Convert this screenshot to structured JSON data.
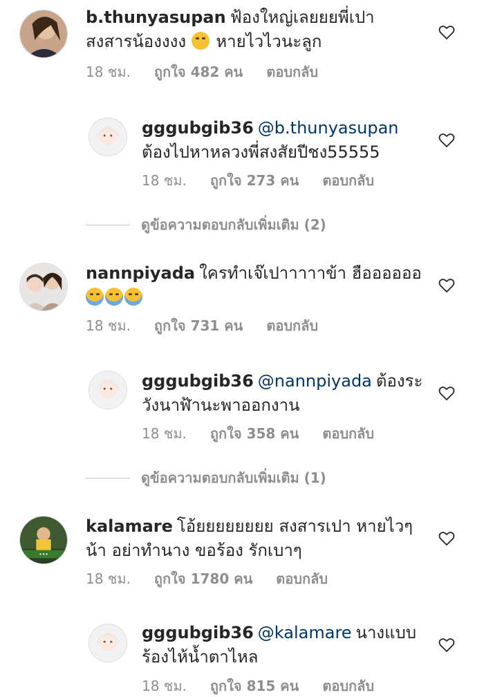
{
  "comments": [
    {
      "username": "b.thunyasupan",
      "text_line1": "ฟ้องใหญ่เลยยยพี่เปา",
      "text_line2": "สงสารน้องงงง",
      "text_line2_tail": "หายไวไวนะลูก",
      "time": "18 ชม.",
      "likes": "ถูกใจ 482 คน",
      "reply": "ตอบกลับ"
    },
    {
      "username": "gggubgib36",
      "mention": "@b.thunyasupan",
      "text_line2": "ต้องไปหาหลวงพี่สงสัยปีชง55555",
      "time": "18 ชม.",
      "likes": "ถูกใจ 273 คน",
      "reply": "ตอบกลับ"
    },
    {
      "view_replies": "ดูข้อความตอบกลับเพิ่มเติม (2)"
    },
    {
      "username": "nannpiyada",
      "text_line1": "ใครทำเจ๊เปาาาาาข้า ฮืออออออ",
      "time": "18 ชม.",
      "likes": "ถูกใจ 731 คน",
      "reply": "ตอบกลับ"
    },
    {
      "username": "gggubgib36",
      "mention": "@nannpiyada",
      "text_line1_tail": "ต้องระ",
      "text_line2": "วังนาฬ้านะพาออกงาน",
      "time": "18 ชม.",
      "likes": "ถูกใจ 358 คน",
      "reply": "ตอบกลับ"
    },
    {
      "view_replies": "ดูข้อความตอบกลับเพิ่มเติม (1)"
    },
    {
      "username": "kalamare",
      "text_line1": "โอ้ยยยยยยยย สงสารเปา หายไวๆ",
      "text_line2": "น้า อย่าทำนาง ขอร้อง รักเบาๆ",
      "time": "18 ชม.",
      "likes": "ถูกใจ 1780 คน",
      "reply": "ตอบกลับ"
    },
    {
      "username": "gggubgib36",
      "mention": "@kalamare",
      "text_line1_tail": "นางแบบ",
      "text_line2": "ร้องไห้น้ำตาไหล",
      "time": "18 ชม.",
      "likes": "ถูกใจ 815 คน",
      "reply": "ตอบกลับ"
    }
  ],
  "icons": {
    "heart": "heart-outline-icon"
  },
  "colors": {
    "text": "#262626",
    "meta": "#8e8e8e",
    "mention": "#00376b",
    "divider": "#c7c7c7"
  }
}
